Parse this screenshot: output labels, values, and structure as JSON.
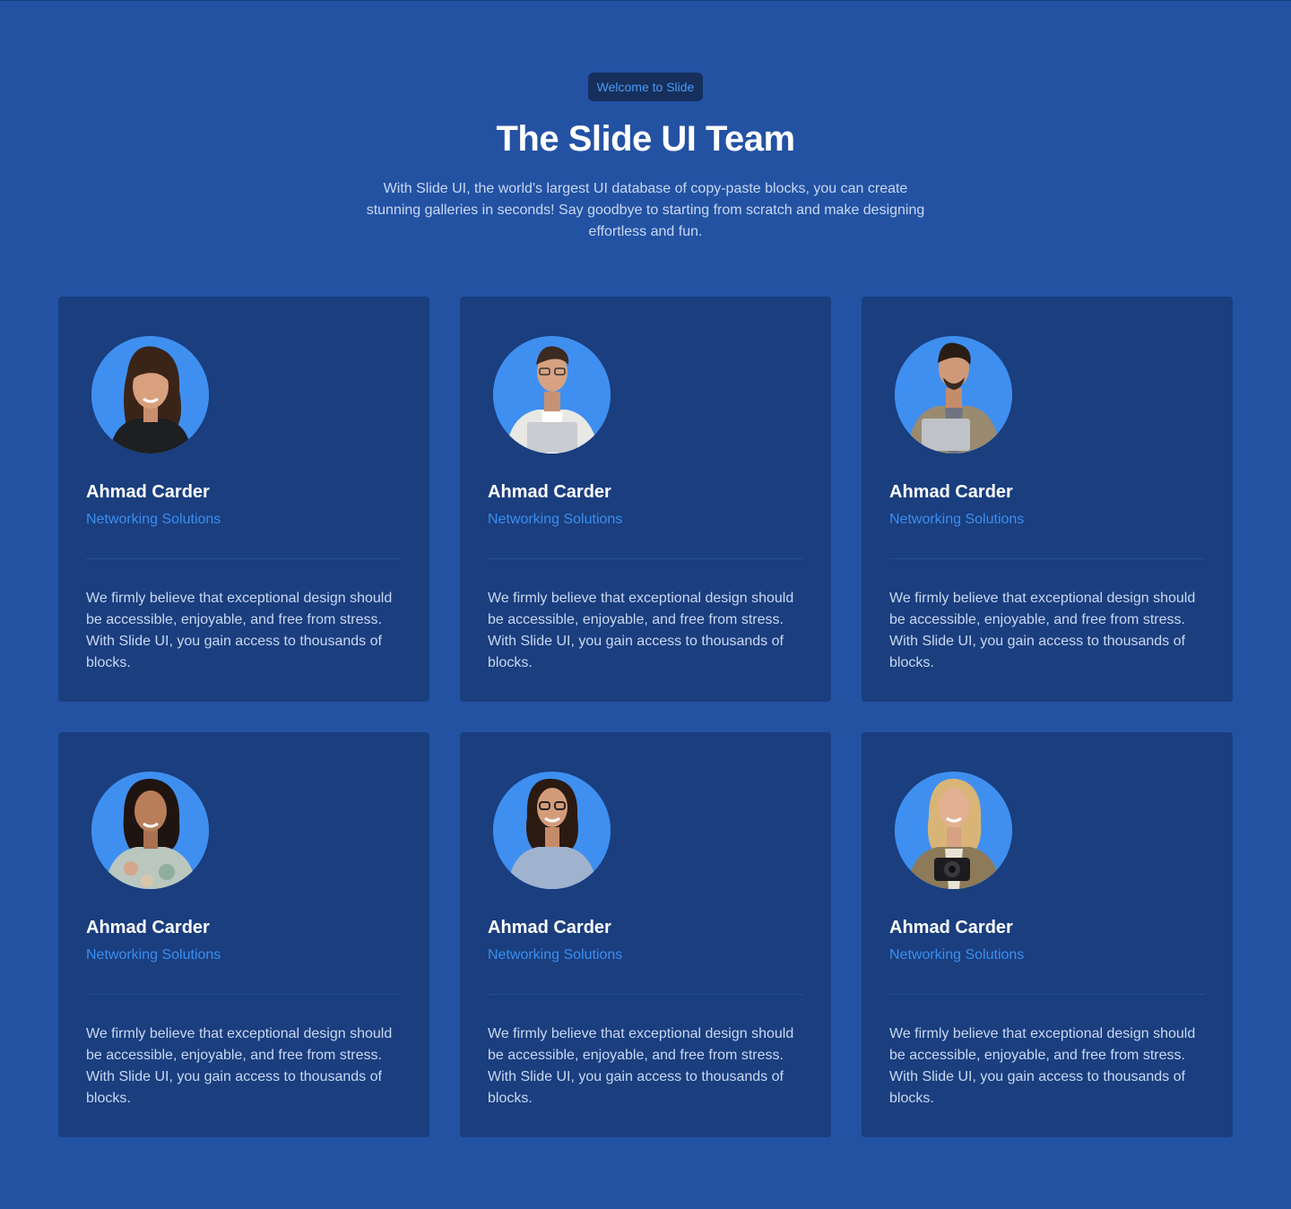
{
  "header": {
    "badge": "Welcome to Slide",
    "title": "The Slide UI Team",
    "subtitle": "With Slide UI, the world's largest UI database of copy-paste blocks, you can create stunning galleries in seconds! Say goodbye to starting from scratch and make designing effortless and fun."
  },
  "colors": {
    "background": "#2352a3",
    "card": "#1a3e7e",
    "accent": "#3b8eef",
    "avatar_bg": "#3f8ff0"
  },
  "team": [
    {
      "name": "Ahmad Carder",
      "role": "Networking Solutions",
      "bio": "We firmly believe that exceptional design should be accessible, enjoyable, and free from stress. With Slide UI, you gain access to thousands of blocks."
    },
    {
      "name": "Ahmad Carder",
      "role": "Networking Solutions",
      "bio": "We firmly believe that exceptional design should be accessible, enjoyable, and free from stress. With Slide UI, you gain access to thousands of blocks."
    },
    {
      "name": "Ahmad Carder",
      "role": "Networking Solutions",
      "bio": "We firmly believe that exceptional design should be accessible, enjoyable, and free from stress. With Slide UI, you gain access to thousands of blocks."
    },
    {
      "name": "Ahmad Carder",
      "role": "Networking Solutions",
      "bio": "We firmly believe that exceptional design should be accessible, enjoyable, and free from stress. With Slide UI, you gain access to thousands of blocks."
    },
    {
      "name": "Ahmad Carder",
      "role": "Networking Solutions",
      "bio": "We firmly believe that exceptional design should be accessible, enjoyable, and free from stress. With Slide UI, you gain access to thousands of blocks."
    },
    {
      "name": "Ahmad Carder",
      "role": "Networking Solutions",
      "bio": "We firmly believe that exceptional design should be accessible, enjoyable, and free from stress. With Slide UI, you gain access to thousands of blocks."
    }
  ]
}
